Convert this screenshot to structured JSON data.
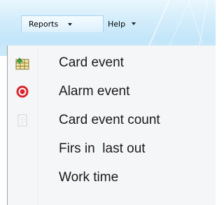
{
  "menubar": {
    "reports_label": "Reports",
    "help_label": "Help"
  },
  "reports_menu": {
    "items": [
      {
        "label": "Card event",
        "icon": "card-event-icon"
      },
      {
        "label": "Alarm event",
        "icon": "alarm-icon"
      },
      {
        "label": "Card event count",
        "icon": "document-icon"
      },
      {
        "label": "Firs in  last out",
        "icon": ""
      },
      {
        "label": "Work time",
        "icon": ""
      }
    ]
  },
  "colors": {
    "menubar_bg": "#cfeaf9",
    "menu_bg": "#f5f6f7",
    "alarm_red": "#d9232e"
  }
}
